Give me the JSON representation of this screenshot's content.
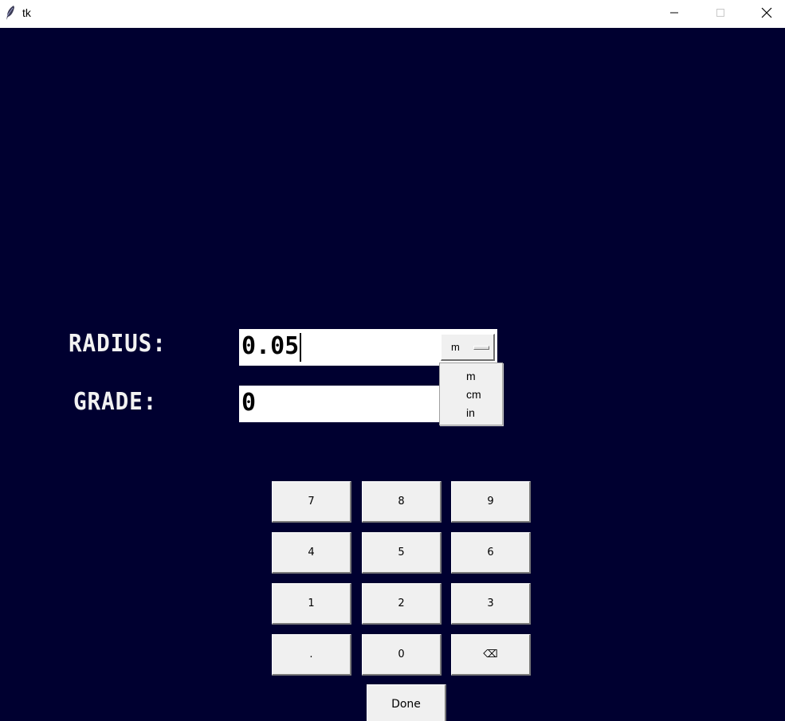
{
  "window": {
    "title": "tk"
  },
  "form": {
    "radius_label": "RADIUS:",
    "radius_value": "0.05",
    "grade_label": "GRADE:",
    "grade_value": "0"
  },
  "unit_menu": {
    "selected": "m",
    "options": [
      "m",
      "cm",
      "in"
    ]
  },
  "keypad": {
    "keys": [
      "7",
      "8",
      "9",
      "4",
      "5",
      "6",
      "1",
      "2",
      "3",
      ".",
      "0",
      "⌫"
    ],
    "done_label": "Done"
  },
  "colors": {
    "background": "#000030",
    "label_text": "#f2f2f2",
    "button_face": "#f0f0f0"
  }
}
